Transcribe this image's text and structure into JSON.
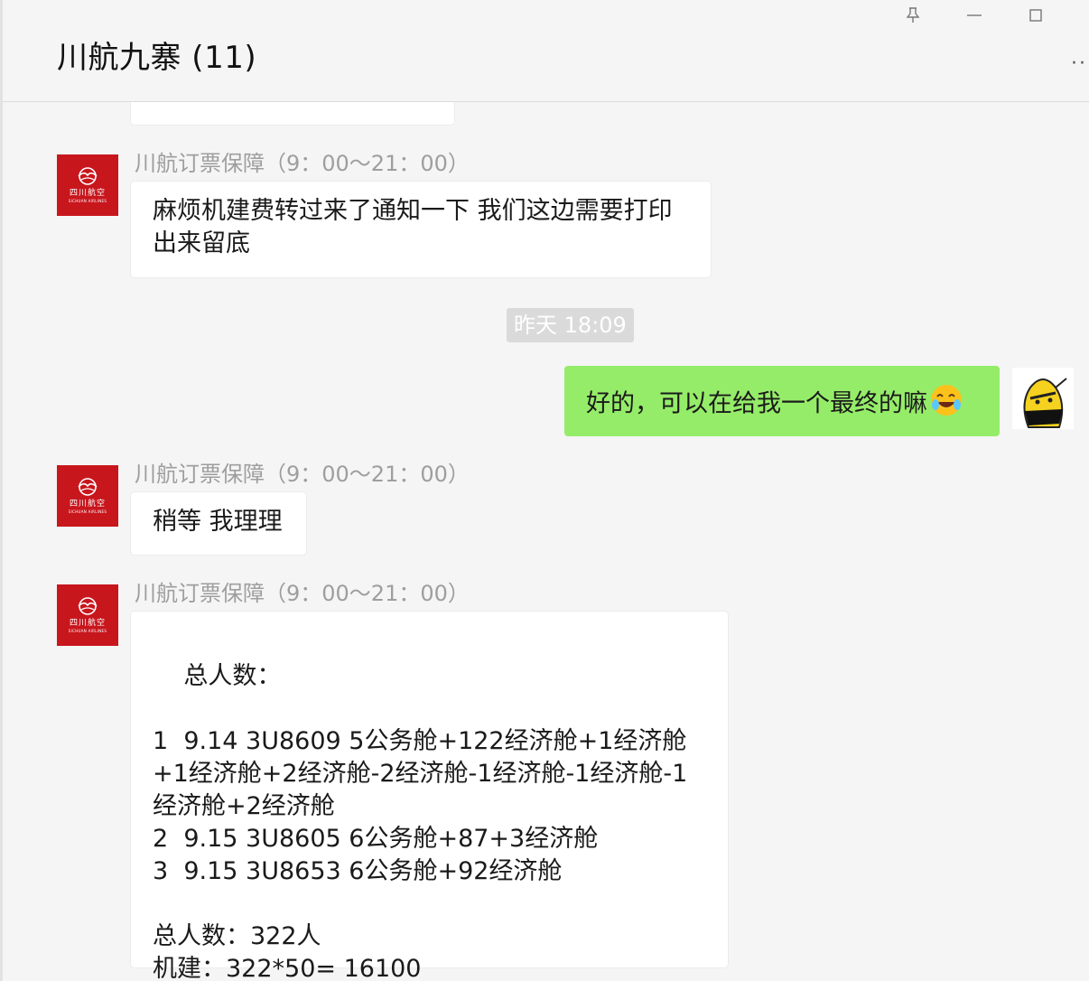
{
  "window": {
    "title": "川航九寨 (11)",
    "pin_icon": "pin-icon",
    "minimize_icon": "minimize-icon",
    "maximize_icon": "maximize-icon",
    "more_icon": "more-icon",
    "more_glyph": "··"
  },
  "sender_avatar": {
    "brand_cn": "四川航空",
    "brand_en": "SICHUAN AIRLINES",
    "color": "#c8161d"
  },
  "messages": {
    "partial": {
      "text": "稍等"
    },
    "m1": {
      "sender": "川航订票保障（9：00～21：00）",
      "text": "麻烦机建费转过来了通知一下 我们这边需要打印出来留底"
    },
    "timestamp": "昨天 18:09",
    "m2": {
      "text": "好的，可以在给我一个最终的嘛",
      "emoji": "rolling-laughing-emoji"
    },
    "m3": {
      "sender": "川航订票保障（9：00～21：00）",
      "text": "稍等 我理理"
    },
    "m4": {
      "sender": "川航订票保障（9：00～21：00）",
      "text": "总人数：\n\n1  9.14 3U8609 5公务舱+122经济舱+1经济舱+1经济舱+2经济舱-2经济舱-1经济舱-1经济舱-1经济舱+2经济舱\n2  9.15 3U8605 6公务舱+87+3经济舱\n3  9.15 3U8653 6公务舱+92经济舱\n\n总人数：322人\n机建：322*50= 16100"
    }
  },
  "colors": {
    "my_bubble": "#95ec69",
    "their_bubble": "#ffffff",
    "background": "#f5f5f5"
  }
}
